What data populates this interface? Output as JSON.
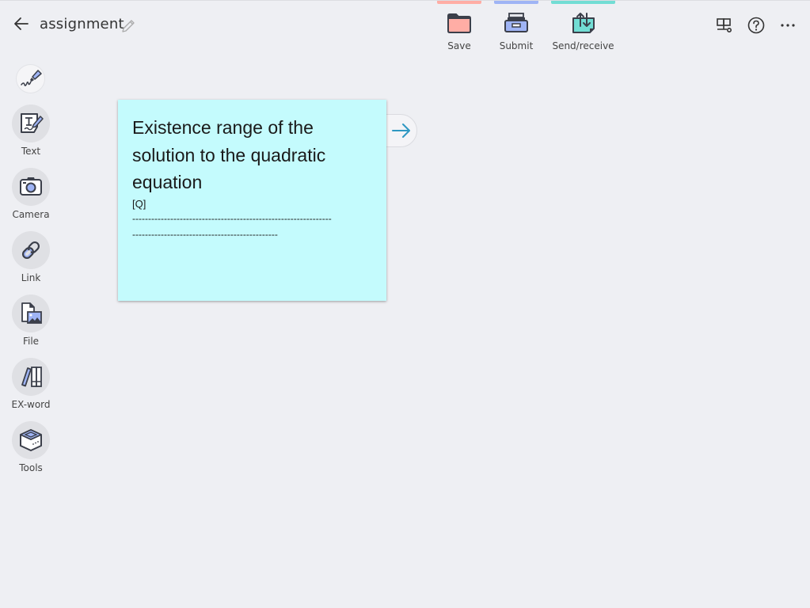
{
  "header": {
    "title": "assignment",
    "back_icon": "arrow-left-icon",
    "edit_icon": "pencil-icon"
  },
  "top_actions": [
    {
      "label": "Save",
      "icon": "folder-icon",
      "color": "#ffada5"
    },
    {
      "label": "Submit",
      "icon": "drawer-tray-icon",
      "color": "#9fb4f5"
    },
    {
      "label": "Send/receive",
      "icon": "send-receive-icon",
      "color": "#72ddd4"
    }
  ],
  "right_icons": [
    "display-board-icon",
    "help-icon",
    "more-icon"
  ],
  "toolbar": {
    "pen_icon": "pen-icon",
    "items": [
      {
        "label": "Text",
        "icon": "text-icon"
      },
      {
        "label": "Camera",
        "icon": "camera-icon"
      },
      {
        "label": "Link",
        "icon": "link-icon"
      },
      {
        "label": "File",
        "icon": "file-image-icon"
      },
      {
        "label": "EX-word",
        "icon": "dictionary-icon"
      },
      {
        "label": "Tools",
        "icon": "tools-box-icon"
      }
    ]
  },
  "card": {
    "heading": "Existence range of the solution to the quadratic equation",
    "marker": "[Q]",
    "dash_line_1": "---------------------------------------------------------------",
    "dash_line_2": "----------------------------------------------",
    "background": "#c4fbfd",
    "next_icon": "arrow-right-icon"
  }
}
